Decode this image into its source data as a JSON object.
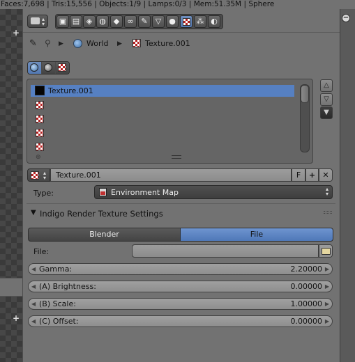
{
  "status_bar": {
    "text": "Faces:7,698 | Tris:15,556 | Objects:1/9 | Lamps:0/3 | Mem:51.35M | Sphere"
  },
  "breadcrumb": {
    "world": "World",
    "texture": "Texture.001"
  },
  "texture_list": {
    "items": [
      "Texture.001",
      "",
      "",
      "",
      ""
    ],
    "selected_index": 0
  },
  "texture_field": {
    "name": "Texture.001",
    "fake_user": "F"
  },
  "type_row": {
    "label": "Type:",
    "value": "Environment Map"
  },
  "section": {
    "title": "Indigo Render Texture Settings"
  },
  "source_toggle": {
    "left": "Blender",
    "right": "File",
    "active": "File"
  },
  "file_row": {
    "label": "File:",
    "value": ""
  },
  "params": [
    {
      "label": "Gamma:",
      "value": "2.20000"
    },
    {
      "label": "(A) Brightness:",
      "value": "0.00000"
    },
    {
      "label": "(B) Scale:",
      "value": "1.00000"
    },
    {
      "label": "(C) Offset:",
      "value": "0.00000"
    }
  ],
  "colors": {
    "accent": "#5680c2",
    "panel": "#727272",
    "selected_row": "#5680c2"
  },
  "icons": {
    "tabs": [
      "render-icon",
      "render-layers-icon",
      "scene-icon",
      "world-icon",
      "object-icon",
      "constraints-icon",
      "modifiers-icon",
      "data-icon",
      "material-icon",
      "texture-icon",
      "particles-icon",
      "physics-icon"
    ]
  }
}
